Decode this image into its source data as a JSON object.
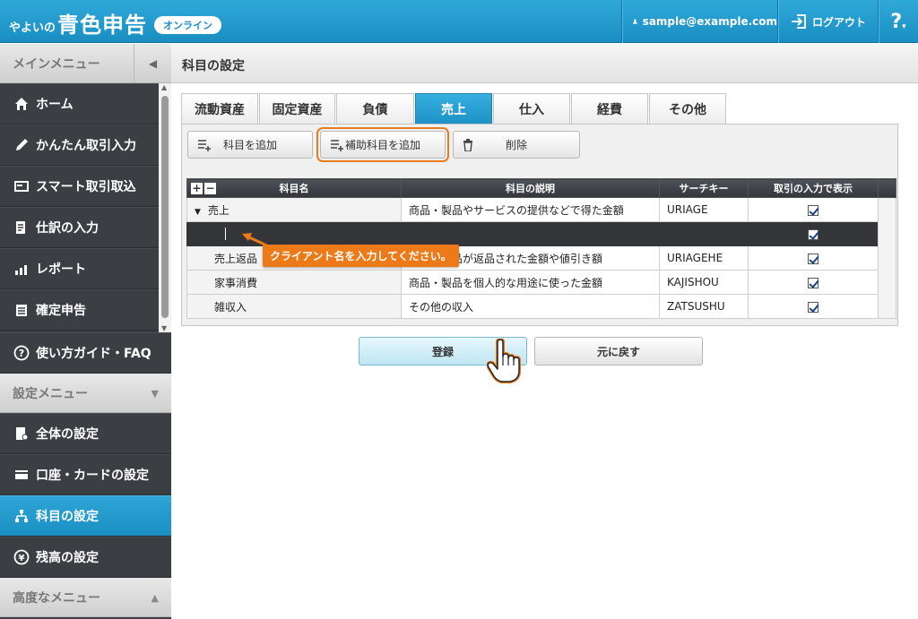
{
  "header": {
    "logo_small": "やよいの",
    "logo_big": "青色申告",
    "logo_badge": "オンライン",
    "user_email": "sample@example.com",
    "logout_label": "ログアウト",
    "help_label": "?"
  },
  "sidebar": {
    "main_menu_label": "メインメニュー",
    "main_items": [
      {
        "label": "ホーム",
        "icon": "home-icon"
      },
      {
        "label": "かんたん取引入力",
        "icon": "pencil-icon"
      },
      {
        "label": "スマート取引取込",
        "icon": "import-icon"
      },
      {
        "label": "仕訳の入力",
        "icon": "journal-icon"
      },
      {
        "label": "レポート",
        "icon": "report-chart-icon"
      },
      {
        "label": "確定申告",
        "icon": "tax-return-icon"
      }
    ],
    "guide_label": "使い方ガイド・FAQ",
    "settings_menu_label": "設定メニュー",
    "settings_items": [
      {
        "label": "全体の設定",
        "icon": "settings-doc-icon"
      },
      {
        "label": "口座・カードの設定",
        "icon": "card-icon"
      },
      {
        "label": "科目の設定",
        "icon": "account-tree-icon"
      },
      {
        "label": "残高の設定",
        "icon": "yen-icon"
      }
    ],
    "advanced_menu_label": "高度なメニュー"
  },
  "main": {
    "title": "科目の設定",
    "tabs": [
      {
        "label": "流動資産",
        "active": false
      },
      {
        "label": "固定資産",
        "active": false
      },
      {
        "label": "負債",
        "active": false
      },
      {
        "label": "売上",
        "active": true
      },
      {
        "label": "仕入",
        "active": false
      },
      {
        "label": "経費",
        "active": false
      },
      {
        "label": "その他",
        "active": false
      }
    ],
    "toolbar": {
      "add_account": "科目を追加",
      "add_sub_account": "補助科目を追加",
      "delete": "削除"
    },
    "table": {
      "headers": [
        "科目名",
        "科目の説明",
        "サーチキー",
        "取引の入力で表示"
      ],
      "rows": [
        {
          "name": "売上",
          "desc": "商品・製品やサービスの提供などで得た金額",
          "key": "URIAGE",
          "checked": true
        },
        {
          "name": "",
          "desc": "",
          "key": "",
          "checked": true
        },
        {
          "name": "売上返品",
          "desc": "商品・製品が返品された金額や値引き額",
          "key": "URIAGEHE",
          "checked": true
        },
        {
          "name": "家事消費",
          "desc": "商品・製品を個人的な用途に使った金額",
          "key": "KAJISHOU",
          "checked": true
        },
        {
          "name": "雑収入",
          "desc": "その他の収入",
          "key": "ZATSUSHU",
          "checked": true
        }
      ]
    },
    "tooltip": "クライアント名を入力してください。",
    "register_label": "登録",
    "back_label": "元に戻す"
  },
  "colors": {
    "accent": "#1e92c6",
    "highlight": "#ec7a18",
    "sidebar_bg": "#3b3f44"
  }
}
